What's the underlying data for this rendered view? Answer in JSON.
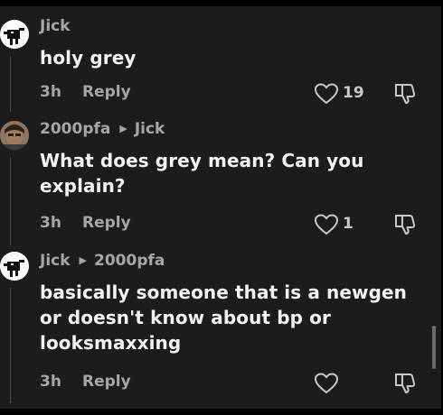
{
  "comments": [
    {
      "author": "Jick",
      "reply_to": "",
      "text": "holy grey",
      "time": "3h",
      "reply_label": "Reply",
      "likes": "19"
    },
    {
      "author": "2000pfa",
      "reply_to": "Jick",
      "text": "What does grey mean? Can you explain?",
      "time": "3h",
      "reply_label": "Reply",
      "likes": "1"
    },
    {
      "author": "Jick",
      "reply_to": "2000pfa",
      "text": "basically someone that is a newgen or doesn't know about bp or looksmaxxing",
      "time": "3h",
      "reply_label": "Reply",
      "likes": ""
    }
  ],
  "icons": {
    "reply_to_caret": "caret-right-icon",
    "like": "heart-outline-icon",
    "dislike": "thumbs-down-icon"
  },
  "colors": {
    "background": "#1c1c1c",
    "text_primary": "#f2f2f2",
    "text_secondary": "#a6a6a6"
  }
}
